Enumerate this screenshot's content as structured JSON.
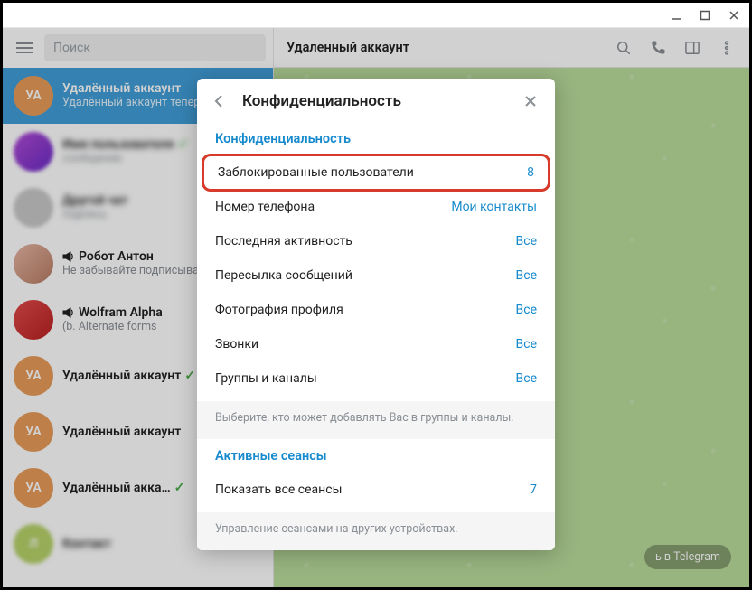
{
  "window": {
    "title_dummy": ""
  },
  "header": {
    "title": "Удаленный аккаунт",
    "pill": "ь в Telegram"
  },
  "search": {
    "placeholder": "Поиск"
  },
  "chats": [
    {
      "initials": "УА",
      "avatar_bg": "#e89c5a",
      "name": "Удалённый аккаунт",
      "sub": "Удалённый аккаунт теперь в",
      "active": true,
      "blur": false,
      "check": false,
      "icon": ""
    },
    {
      "initials": "",
      "avatar_bg": "linear-gradient(135deg,#b24bd6,#6b2bc7)",
      "name": "Имя пользователя",
      "sub": "сообщение",
      "active": false,
      "blur": true,
      "check": true,
      "icon": ""
    },
    {
      "initials": "",
      "avatar_bg": "#c9c9c9",
      "name": "Другой чат",
      "sub": "подпись",
      "active": false,
      "blur": true,
      "check": false,
      "icon": ""
    },
    {
      "initials": "",
      "avatar_bg": "linear-gradient(135deg,#e7b7a5,#b77b63)",
      "name": "Робот Антон",
      "sub": "Не забывайте подписываться",
      "active": false,
      "blur": false,
      "check": false,
      "icon": "speaker"
    },
    {
      "initials": "",
      "avatar_bg": "linear-gradient(135deg,#e14b4b,#b22)",
      "name": "Wolfram Alpha",
      "sub": "(b. Alternate forms",
      "active": false,
      "blur": false,
      "check": false,
      "icon": "speaker"
    },
    {
      "initials": "УА",
      "avatar_bg": "#e89c5a",
      "name": "Удалённый аккаунт",
      "sub": "",
      "active": false,
      "blur": false,
      "check": true,
      "icon": ""
    },
    {
      "initials": "УА",
      "avatar_bg": "#e89c5a",
      "name": "Удалённый аккаунт",
      "sub": "",
      "active": false,
      "blur": false,
      "check": false,
      "icon": ""
    },
    {
      "initials": "УА",
      "avatar_bg": "#e89c5a",
      "name": "Удалённый акка…",
      "sub": "",
      "active": false,
      "blur": false,
      "check": true,
      "icon": ""
    },
    {
      "initials": "Л",
      "avatar_bg": "#b7d36a",
      "name": "Контакт",
      "sub": "",
      "active": false,
      "blur": true,
      "check": false,
      "icon": ""
    }
  ],
  "panel": {
    "title": "Конфиденциальность",
    "section1_header": "Конфиденциальность",
    "rows": [
      {
        "label": "Заблокированные пользователи",
        "value": "8",
        "highlight": true
      },
      {
        "label": "Номер телефона",
        "value": "Мои контакты",
        "highlight": false
      },
      {
        "label": "Последняя активность",
        "value": "Все",
        "highlight": false
      },
      {
        "label": "Пересылка сообщений",
        "value": "Все",
        "highlight": false
      },
      {
        "label": "Фотография профиля",
        "value": "Все",
        "highlight": false
      },
      {
        "label": "Звонки",
        "value": "Все",
        "highlight": false
      },
      {
        "label": "Группы и каналы",
        "value": "Все",
        "highlight": false
      }
    ],
    "note1": "Выберите, кто может добавлять Вас в группы и каналы.",
    "section2_header": "Активные сеансы",
    "rows2": [
      {
        "label": "Показать все сеансы",
        "value": "7"
      }
    ],
    "note2": "Управление сеансами на других устройствах."
  }
}
